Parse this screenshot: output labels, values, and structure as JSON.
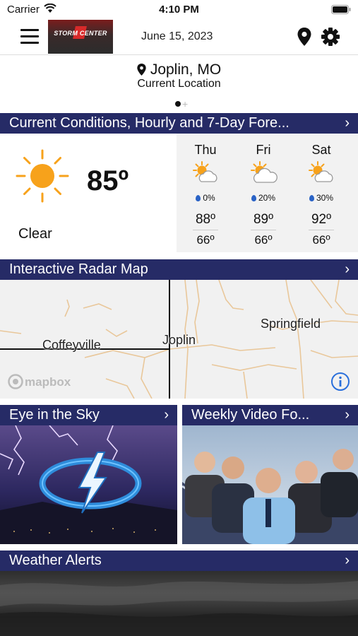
{
  "status_bar": {
    "carrier": "Carrier",
    "time": "4:10 PM"
  },
  "header": {
    "logo_text": "STORM CENTER",
    "date": "June 15, 2023"
  },
  "location": {
    "city": "Joplin, MO",
    "subtitle": "Current Location"
  },
  "conditions_section": {
    "title": "Current Conditions, Hourly and 7-Day Fore...",
    "current": {
      "temp": "85º",
      "condition": "Clear",
      "icon": "sunny-icon"
    },
    "days": [
      {
        "name": "Thu",
        "icon": "partly-cloudy-icon",
        "precip": "0%",
        "high": "88º",
        "low": "66º"
      },
      {
        "name": "Fri",
        "icon": "partly-cloudy-icon",
        "precip": "20%",
        "high": "89º",
        "low": "66º"
      },
      {
        "name": "Sat",
        "icon": "partly-cloudy-icon",
        "precip": "30%",
        "high": "92º",
        "low": "66º"
      }
    ]
  },
  "radar_section": {
    "title": "Interactive Radar Map",
    "cities": [
      "Coffeyville",
      "Joplin",
      "Springfield"
    ],
    "attribution": "mapbox"
  },
  "tiles": [
    {
      "title": "Eye in the Sky"
    },
    {
      "title": "Weekly Video Fo..."
    }
  ],
  "alerts_section": {
    "title": "Weather Alerts"
  },
  "colors": {
    "section_bar": "#262b66",
    "sun": "#f7a21b",
    "precip_drop": "#2a63c6",
    "info": "#2a6fdb"
  }
}
